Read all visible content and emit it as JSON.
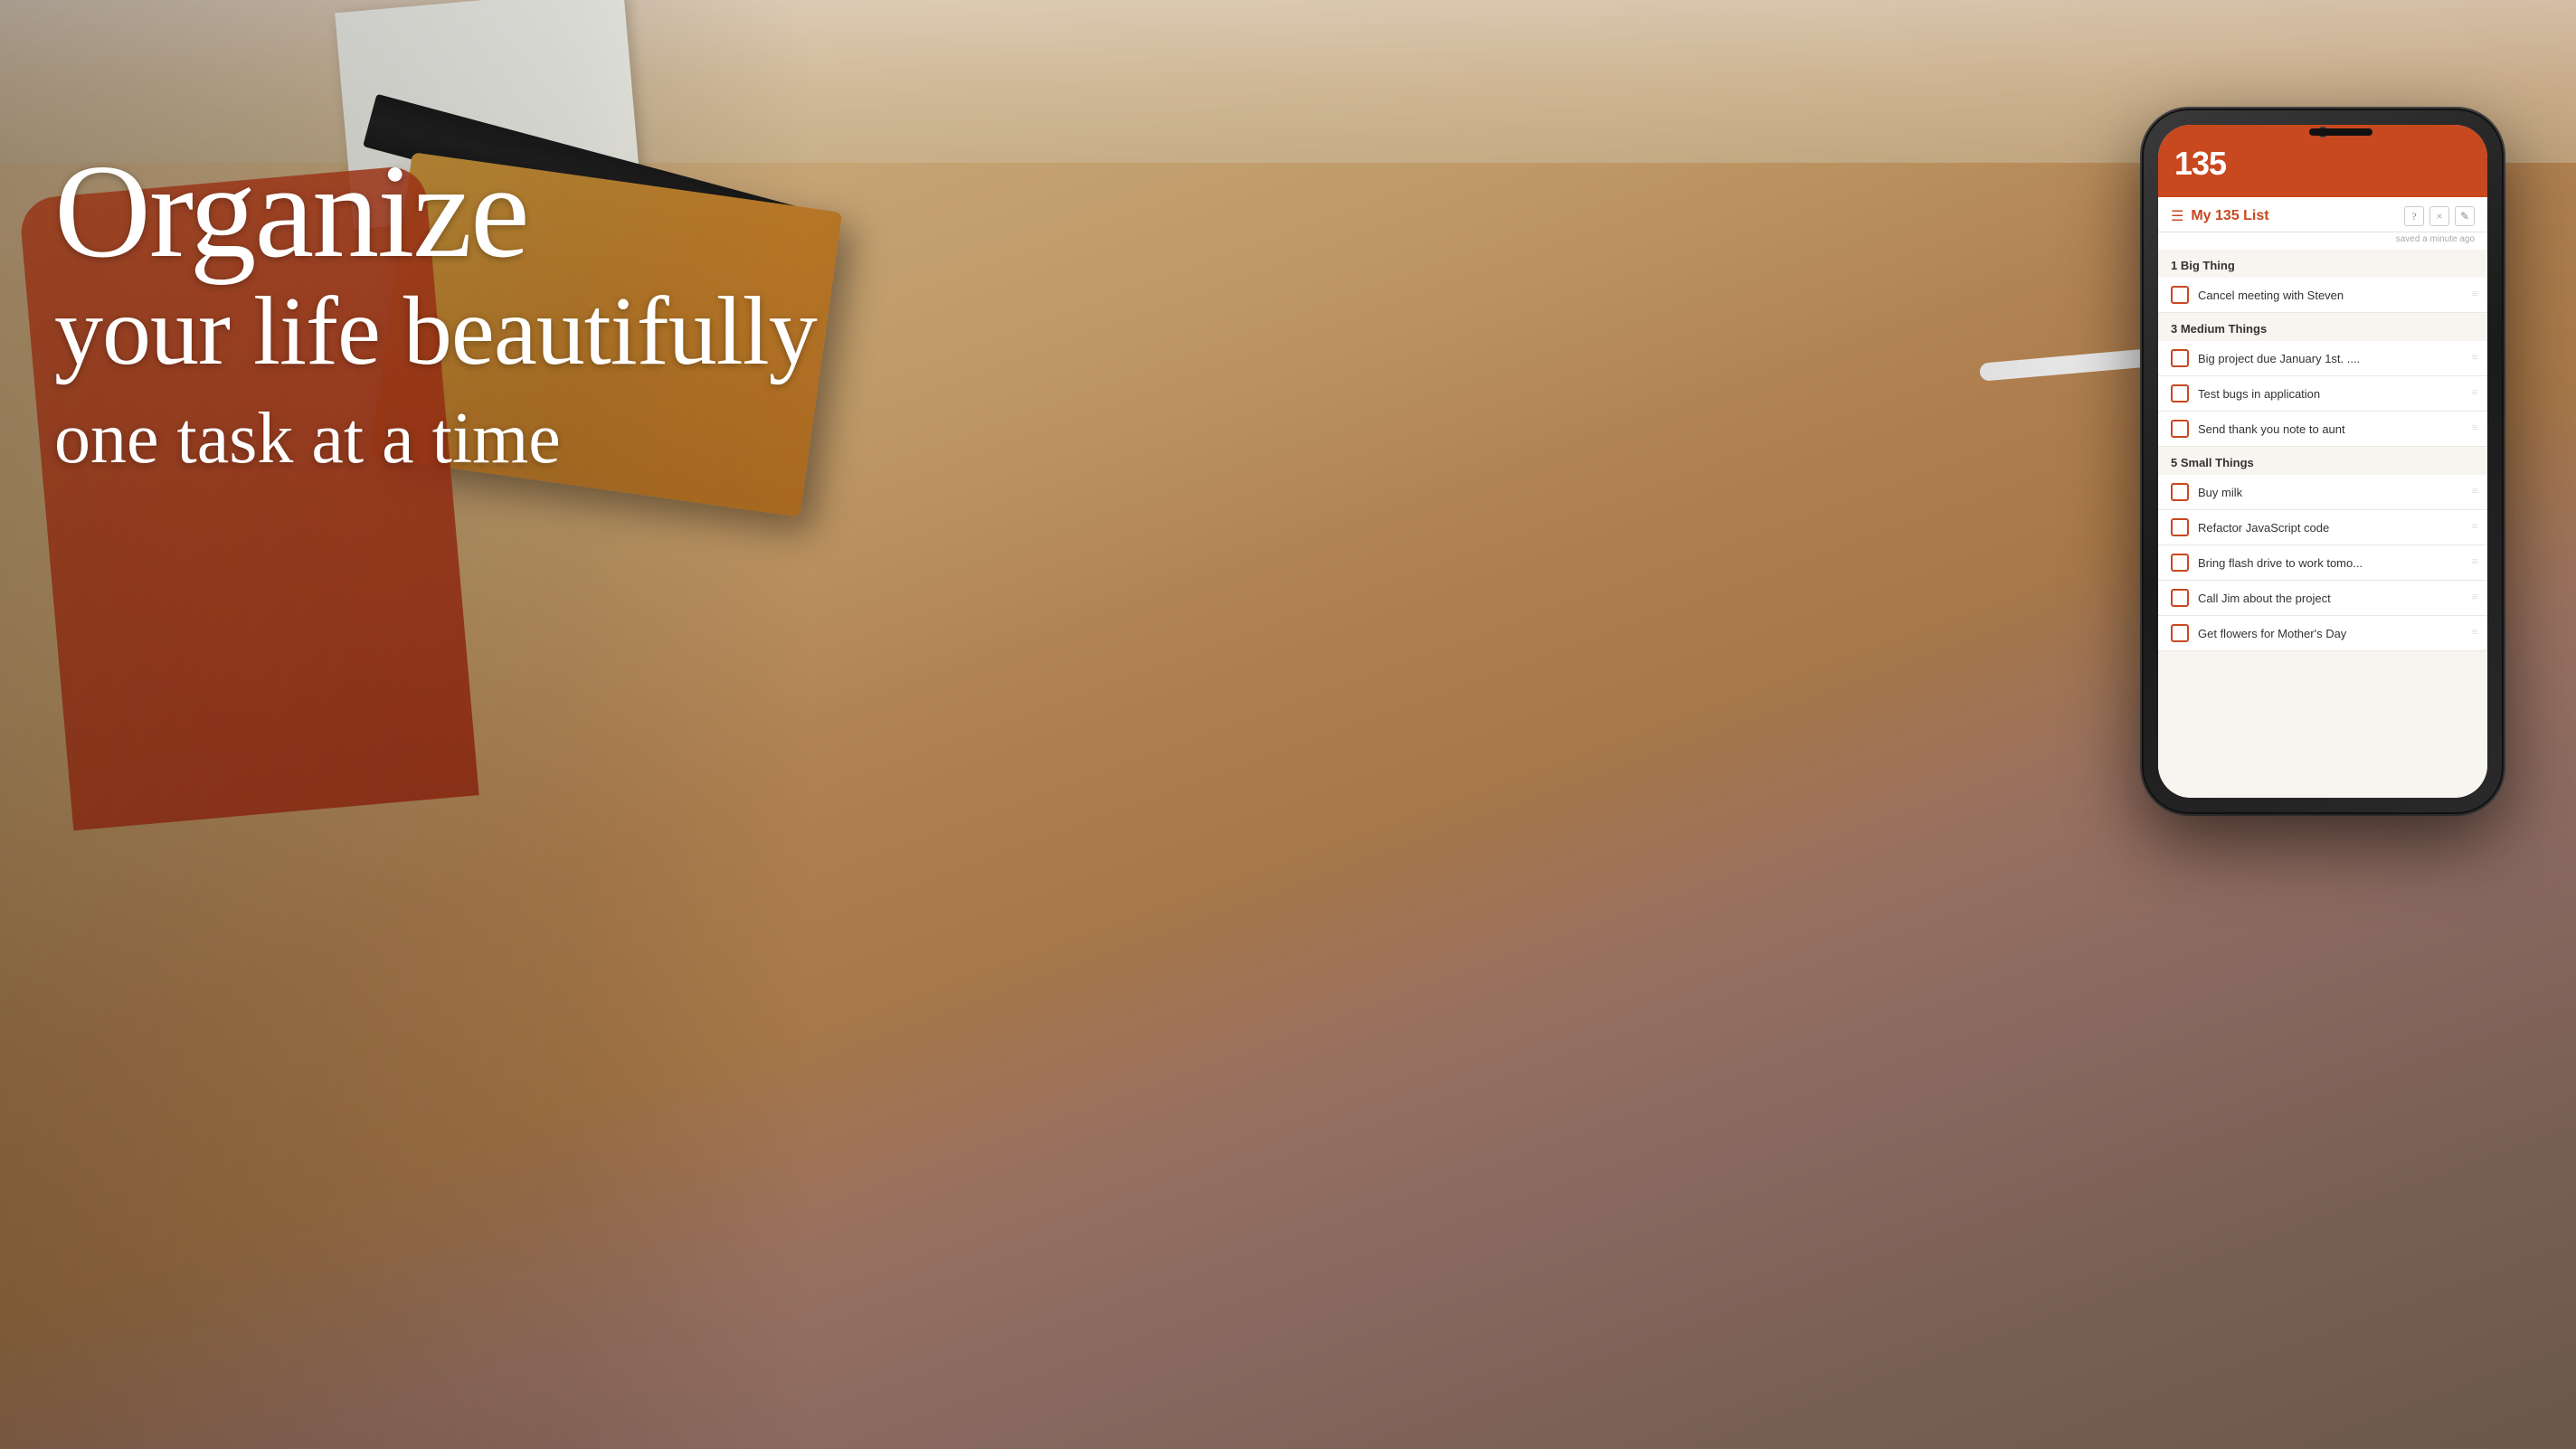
{
  "hero": {
    "line1": "Organize",
    "line2": "your life beautifully",
    "line3": "one task at a time"
  },
  "app": {
    "logo": "135",
    "list_title": "My 135 List",
    "saved_text": "saved a minute ago",
    "action_info": "?",
    "action_close": "×",
    "action_edit": "✎",
    "sections": [
      {
        "label": "1 Big Thing",
        "tasks": [
          {
            "text": "Cancel meeting with Steven",
            "checked": false
          }
        ]
      },
      {
        "label": "3 Medium Things",
        "tasks": [
          {
            "text": "Big project due January 1st. ....",
            "checked": false
          },
          {
            "text": "Test bugs in application",
            "checked": false
          },
          {
            "text": "Send thank you note to aunt",
            "checked": false
          }
        ]
      },
      {
        "label": "5 Small Things",
        "tasks": [
          {
            "text": "Buy milk",
            "checked": false
          },
          {
            "text": "Refactor JavaScript code",
            "checked": false
          },
          {
            "text": "Bring flash drive to work tomo...",
            "checked": false
          },
          {
            "text": "Call Jim about the project",
            "checked": false
          },
          {
            "text": "Get flowers for Mother's Day",
            "checked": false
          }
        ]
      }
    ]
  },
  "colors": {
    "accent": "#c84820",
    "bg": "#b8956a"
  }
}
